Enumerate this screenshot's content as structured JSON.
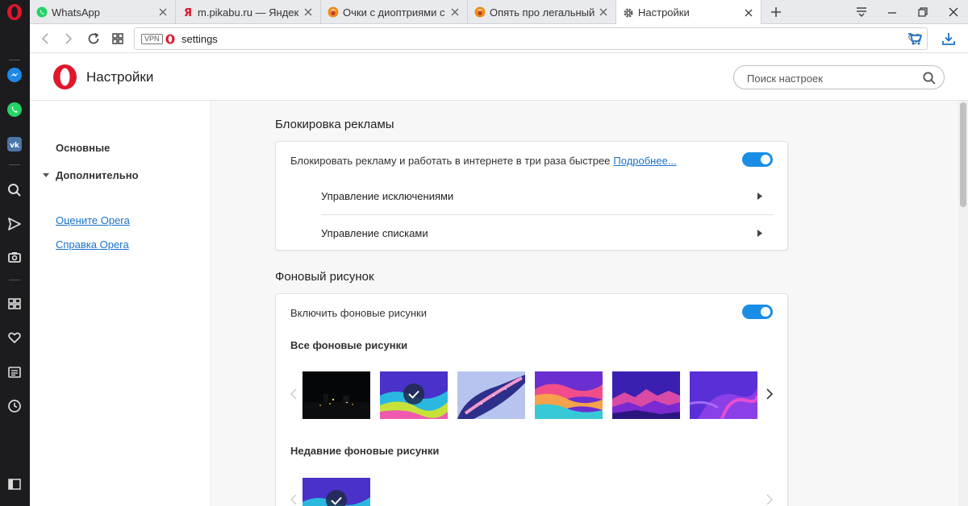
{
  "tabs": [
    {
      "title": "WhatsApp",
      "favicon": "whatsapp-icon"
    },
    {
      "title": "m.pikabu.ru — Яндекс: на",
      "favicon": "yandex-icon"
    },
    {
      "title": "Очки с диоптриями с али",
      "favicon": "pikabu-icon"
    },
    {
      "title": "Опять про легальный кон",
      "favicon": "pikabu-icon"
    },
    {
      "title": "Настройки",
      "favicon": "gear-icon"
    }
  ],
  "address_bar": {
    "vpn_label": "VPN",
    "url": "settings"
  },
  "header": {
    "title": "Настройки",
    "search_placeholder": "Поиск настроек"
  },
  "nav": {
    "basic": "Основные",
    "advanced": "Дополнительно",
    "rate_link": "Оцените Opera",
    "help_link": "Справка Opera"
  },
  "ad_block": {
    "section_title": "Блокировка рекламы",
    "toggle_label": "Блокировать рекламу и работать в интернете в три раза быстрее",
    "learn_more": "Подробнее...",
    "enabled": true,
    "rows": [
      {
        "label": "Управление исключениями"
      },
      {
        "label": "Управление списками"
      }
    ]
  },
  "wallpaper": {
    "section_title": "Фоновый рисунок",
    "toggle_label": "Включить фоновые рисунки",
    "enabled": true,
    "all_heading": "Все фоновые рисунки",
    "recent_heading": "Недавние фоновые рисунки",
    "selected_index": 1
  },
  "colors": {
    "opera_red": "#e0162b",
    "accent_blue": "#1a8ee6",
    "link_blue": "#1a73c8"
  }
}
